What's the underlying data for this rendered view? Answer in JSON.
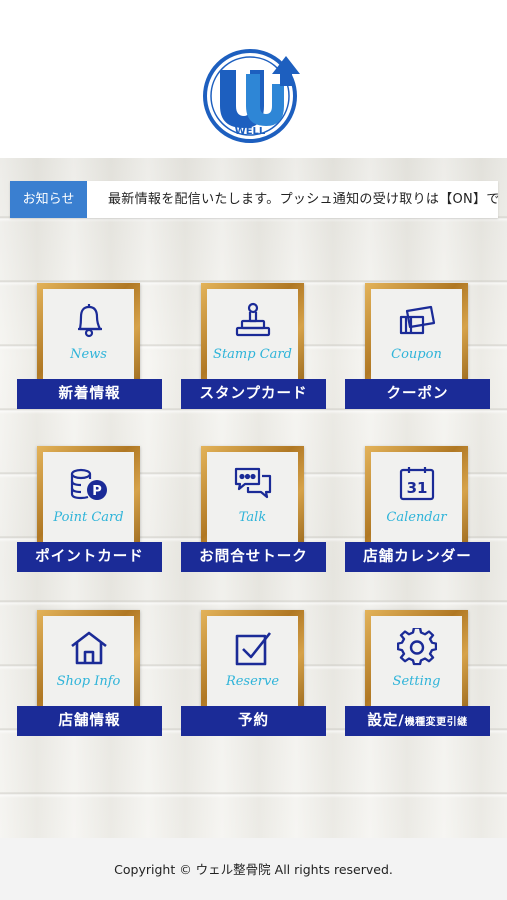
{
  "brand": {
    "logo_text": "WELL",
    "colors": {
      "primary": "#1b2b97",
      "accent": "#3a7fd0",
      "script": "#2fb4d9"
    }
  },
  "news": {
    "badge": "お知らせ",
    "ticker": "最新情報を配信いたします。プッシュ通知の受け取りは【ON】で"
  },
  "menu": [
    {
      "icon": "bell-icon",
      "script": "News",
      "label": "新着情報"
    },
    {
      "icon": "stamp-icon",
      "script": "Stamp Card",
      "label": "スタンプカード"
    },
    {
      "icon": "coupon-icon",
      "script": "Coupon",
      "label": "クーポン"
    },
    {
      "icon": "coins-icon",
      "script": "Point Card",
      "label": "ポイントカード"
    },
    {
      "icon": "chat-icon",
      "script": "Talk",
      "label": "お問合せトーク"
    },
    {
      "icon": "calendar-icon",
      "script": "Calendar",
      "label": "店舗カレンダー",
      "calendar_day": "31"
    },
    {
      "icon": "house-icon",
      "script": "Shop Info",
      "label": "店舗情報"
    },
    {
      "icon": "checkbox-icon",
      "script": "Reserve",
      "label": "予約"
    },
    {
      "icon": "gear-icon",
      "script": "Setting",
      "label": "設定/",
      "label_small": "機種変更引継"
    }
  ],
  "footer": {
    "copyright": "Copyright © ウェル整骨院 All rights reserved."
  }
}
